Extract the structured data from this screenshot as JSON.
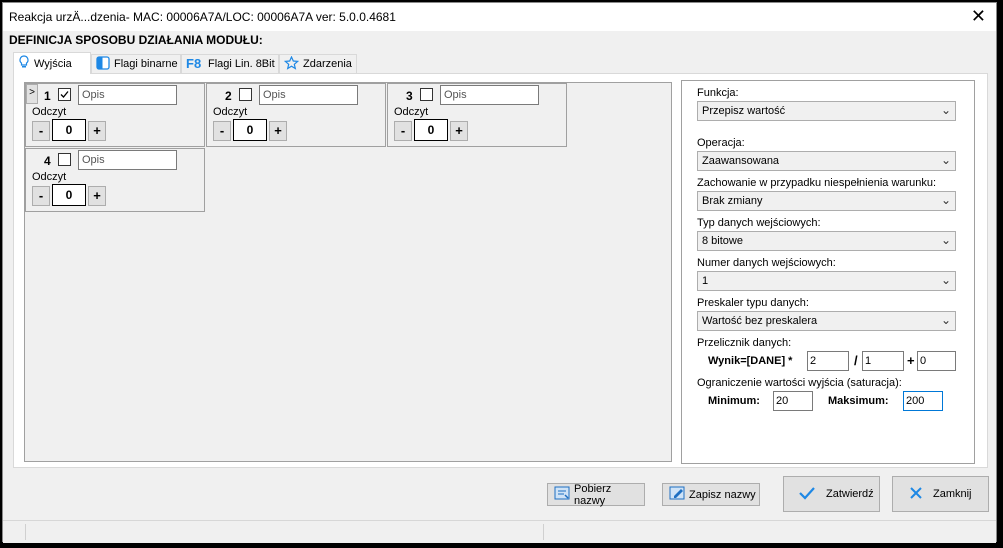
{
  "window": {
    "title": "Reakcja urzÄ...dzenia- MAC: 00006A7A/LOC: 00006A7A ver: 5.0.0.4681",
    "close_glyph": "✕"
  },
  "heading": "DEFINICJA SPOSOBU DZIAŁANIA MODUŁU:",
  "tabs": [
    {
      "label": "Wyjścia",
      "icon": "lightbulb-icon",
      "active": true
    },
    {
      "label": "Flagi binarne",
      "icon": "flag-binary-icon",
      "active": false
    },
    {
      "label": "Flagi Lin. 8Bit",
      "icon": "f8-icon",
      "active": false
    },
    {
      "label": "Zdarzenia",
      "icon": "star-icon",
      "active": false
    }
  ],
  "outputs": [
    {
      "num": "1",
      "checked": true,
      "opis": "Opis",
      "label": "Odczyt",
      "value": "0",
      "minus": "-",
      "plus": "+"
    },
    {
      "num": "2",
      "checked": false,
      "opis": "Opis",
      "label": "Odczyt",
      "value": "0",
      "minus": "-",
      "plus": "+"
    },
    {
      "num": "3",
      "checked": false,
      "opis": "Opis",
      "label": "Odczyt",
      "value": "0",
      "minus": "-",
      "plus": "+"
    },
    {
      "num": "4",
      "checked": false,
      "opis": "Opis",
      "label": "Odczyt",
      "value": "0",
      "minus": "-",
      "plus": "+"
    }
  ],
  "selector_marker": ">",
  "props": {
    "funkcja_label": "Funkcja:",
    "funkcja_value": "Przepisz wartość",
    "operacja_label": "Operacja:",
    "operacja_value": "Zaawansowana",
    "zachowanie_label": "Zachowanie w przypadku niespełnienia warunku:",
    "zachowanie_value": "Brak zmiany",
    "typ_label": "Typ danych wejściowych:",
    "typ_value": "8 bitowe",
    "numer_label": "Numer danych wejściowych:",
    "numer_value": "1",
    "preskaler_label": "Preskaler typu danych:",
    "preskaler_value": "Wartość bez preskalera",
    "przelicznik_label": "Przelicznik danych:",
    "wynik_label": "Wynik=[DANE] *",
    "mul_value": "2",
    "div_sign": "/",
    "div_value": "1",
    "add_sign": "+",
    "add_value": "0",
    "ograniczenie_label": "Ograniczenie wartości wyjścia (saturacja):",
    "min_label": "Minimum:",
    "min_value": "20",
    "max_label": "Maksimum:",
    "max_value": "200"
  },
  "buttons": {
    "pobierz": "Pobierz nazwy",
    "zapisz": "Zapisz nazwy",
    "zatwierdz": "Zatwierdź",
    "zamknij": "Zamknij"
  }
}
